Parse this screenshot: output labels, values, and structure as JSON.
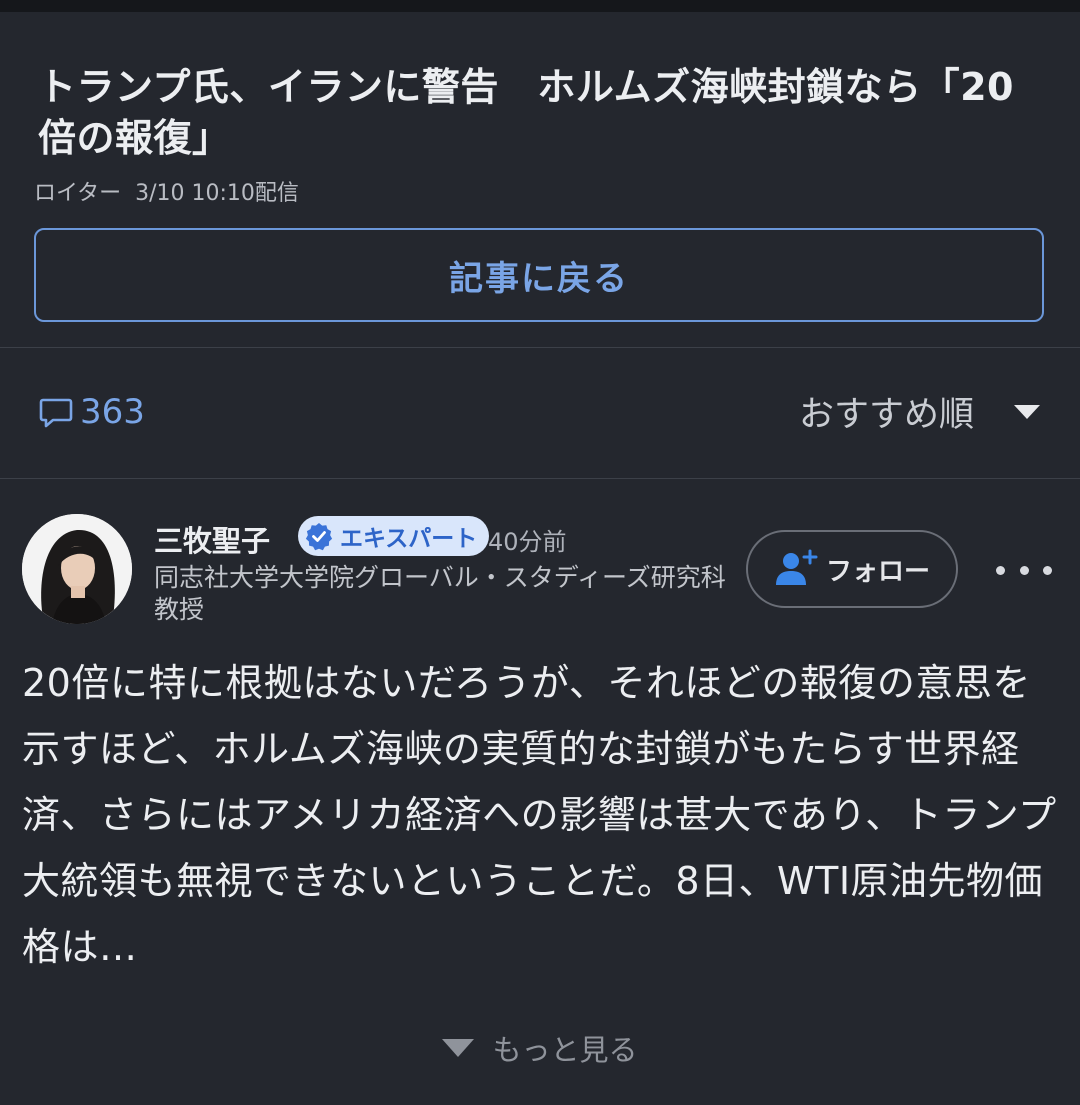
{
  "article": {
    "headline": "トランプ氏、イランに警告　ホルムズ海峡封鎖なら「20倍の報復」",
    "source": "ロイター",
    "published": "3/10 10:10配信",
    "back_label": "記事に戻る"
  },
  "comments_bar": {
    "count": "363",
    "sort_label": "おすすめ順",
    "icons": {
      "comment": "comment-bubble-icon",
      "sort": "caret-down-icon"
    }
  },
  "comment": {
    "author": "三牧聖子",
    "badge": "エキスパート",
    "time_ago": "40分前",
    "affiliation": "同志社大学大学院グローバル・スタディーズ研究科教授",
    "follow_label": "フォロー",
    "body": "20倍に特に根拠はないだろうが、それほどの報復の意思を示すほど、ホルムズ海峡の実質的な封鎖がもたらす世界経済、さらにはアメリカ経済への影響は甚大であり、トランプ大統領も無視できないということだ。8日、WTI原油先物価格は…",
    "show_more_label": "もっと見る",
    "icons": {
      "verified": "verified-check-icon",
      "follow": "person-add-icon",
      "menu": "more-horizontal-icon",
      "expand": "triangle-down-icon"
    }
  },
  "colors": {
    "background": "#24272e",
    "accent": "#7aa5e6",
    "badge_bg": "#d9e6fb",
    "badge_text": "#2d64c8"
  }
}
